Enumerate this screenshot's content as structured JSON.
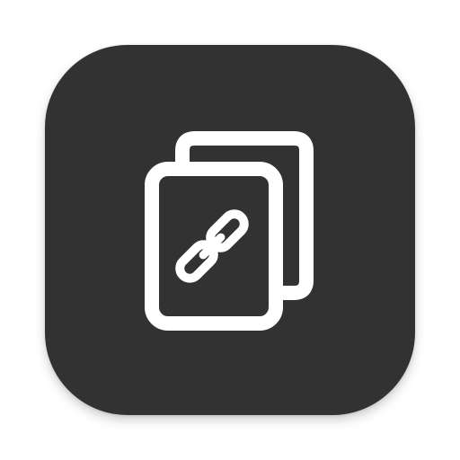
{
  "app_icon": {
    "icon": "linked-documents-icon",
    "tile_color": "#333233",
    "glyph_color": "#ffffff",
    "parts": {
      "back_page": "document-page-icon",
      "front_page": "document-page-icon",
      "link": "chain-link-icon"
    }
  }
}
